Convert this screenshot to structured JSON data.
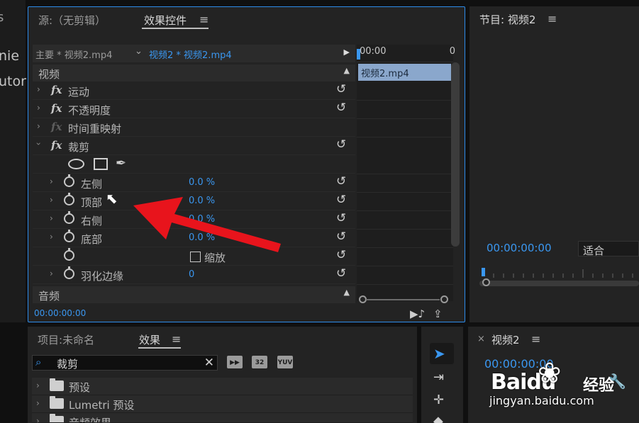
{
  "left_panel": {
    "lines": [
      "nie",
      "utor"
    ]
  },
  "effect_controls": {
    "tabs": {
      "source": "源:（无剪辑）",
      "effect_controls": "效果控件"
    },
    "header": {
      "master": "主要 * 视频2.mp4",
      "sequence": "视频2 * 视频2.mp4"
    },
    "mini_timeline": {
      "start": "00:00",
      "end": "0",
      "clip": "视频2.mp4"
    },
    "video_section": "视频",
    "effects": [
      {
        "name": "运动"
      },
      {
        "name": "不透明度"
      },
      {
        "name": "时间重映射"
      },
      {
        "name": "裁剪"
      }
    ],
    "crop_params": [
      {
        "name": "左侧",
        "value": "0.0 %"
      },
      {
        "name": "顶部",
        "value": "0.0 %"
      },
      {
        "name": "右侧",
        "value": "0.0 %"
      },
      {
        "name": "底部",
        "value": "0.0 %"
      }
    ],
    "zoom_label": "缩放",
    "feather": {
      "name": "羽化边缘",
      "value": "0"
    },
    "audio_section": "音频",
    "timecode": "00:00:00:00"
  },
  "program_monitor": {
    "title": "节目: 视频2",
    "timecode": "00:00:00:00",
    "fit": "适合"
  },
  "project_panel": {
    "tabs": {
      "project": "项目:未命名",
      "effects": "效果"
    },
    "search_value": "裁剪",
    "bin_labels": [
      "32",
      "YUV"
    ],
    "folders": [
      "预设",
      "Lumetri 预设",
      "音频效果"
    ]
  },
  "timeline": {
    "title": "视频2",
    "timecode": "00:00:00:00"
  },
  "watermark": {
    "logo": "Baidu",
    "brand": "经验",
    "url": "jingyan.baidu.com"
  },
  "colors": {
    "accent": "#2d8ceb",
    "arrow": "#e8141c"
  }
}
